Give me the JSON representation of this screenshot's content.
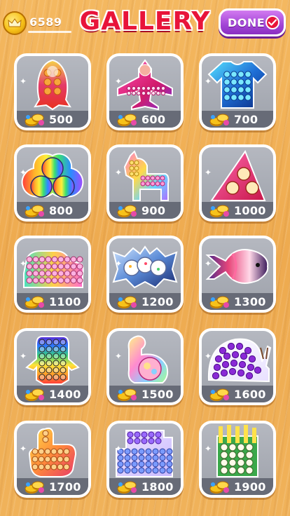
{
  "header": {
    "coins": "6589",
    "title": "GALLERY",
    "done_label": "DONE"
  },
  "items": [
    {
      "price": "500",
      "art": "rocket-popit-icon"
    },
    {
      "price": "600",
      "art": "airplane-popit-icon"
    },
    {
      "price": "700",
      "art": "tshirt-popit-icon"
    },
    {
      "price": "800",
      "art": "triple-circle-popit-icon"
    },
    {
      "price": "900",
      "art": "unicorn-popit-icon"
    },
    {
      "price": "1000",
      "art": "triangle-popit-icon"
    },
    {
      "price": "1100",
      "art": "car-popit-icon"
    },
    {
      "price": "1200",
      "art": "bat-popit-icon"
    },
    {
      "price": "1300",
      "art": "fish-popit-icon"
    },
    {
      "price": "1400",
      "art": "penguin-popit-icon"
    },
    {
      "price": "1500",
      "art": "dinosaur-popit-icon"
    },
    {
      "price": "1600",
      "art": "snail-popit-icon"
    },
    {
      "price": "1700",
      "art": "hand-popit-icon"
    },
    {
      "price": "1800",
      "art": "house-popit-icon"
    },
    {
      "price": "1900",
      "art": "fries-popit-icon"
    }
  ],
  "colors": {
    "title_red": "#e8143a",
    "done_purple": "#a245d6",
    "card_white": "#ffffff",
    "price_bar": "#676b77",
    "background_wood": "#eeaa4f"
  }
}
